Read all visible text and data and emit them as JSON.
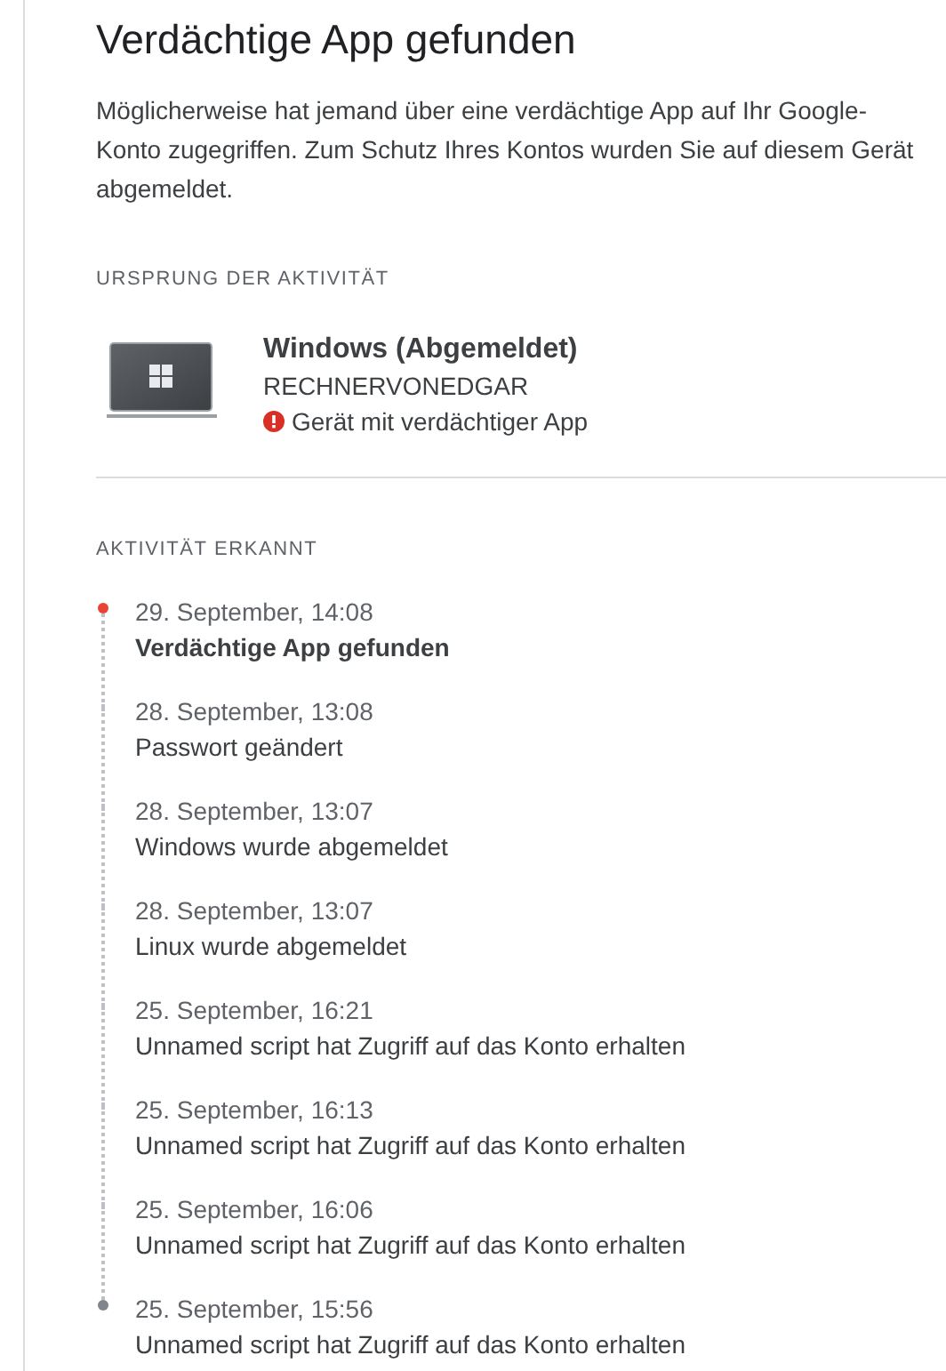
{
  "title": "Verdächtige App gefunden",
  "description": "Möglicherweise hat jemand über eine verdächtige App auf Ihr Google-Konto zugegriffen. Zum Schutz Ihres Kontos wurden Sie auf diesem Gerät abgemeldet.",
  "origin": {
    "heading": "URSPRUNG DER AKTIVITÄT",
    "device": "Windows (Abgemeldet)",
    "name": "RECHNERVONEDGAR",
    "warning": "Gerät mit verdächtiger App"
  },
  "activity": {
    "heading": "AKTIVITÄT ERKANNT",
    "events": [
      {
        "time": "29. September, 14:08",
        "text": "Verdächtige App gefunden",
        "emphasized": true
      },
      {
        "time": "28. September, 13:08",
        "text": "Passwort geändert",
        "emphasized": false
      },
      {
        "time": "28. September, 13:07",
        "text": "Windows wurde abgemeldet",
        "emphasized": false
      },
      {
        "time": "28. September, 13:07",
        "text": "Linux wurde abgemeldet",
        "emphasized": false
      },
      {
        "time": "25. September, 16:21",
        "text": "Unnamed script hat Zugriff auf das Konto erhalten",
        "emphasized": false
      },
      {
        "time": "25. September, 16:13",
        "text": "Unnamed script hat Zugriff auf das Konto erhalten",
        "emphasized": false
      },
      {
        "time": "25. September, 16:06",
        "text": "Unnamed script hat Zugriff auf das Konto erhalten",
        "emphasized": false
      },
      {
        "time": "25. September, 15:56",
        "text": "Unnamed script hat Zugriff auf das Konto erhalten",
        "emphasized": false
      }
    ]
  }
}
